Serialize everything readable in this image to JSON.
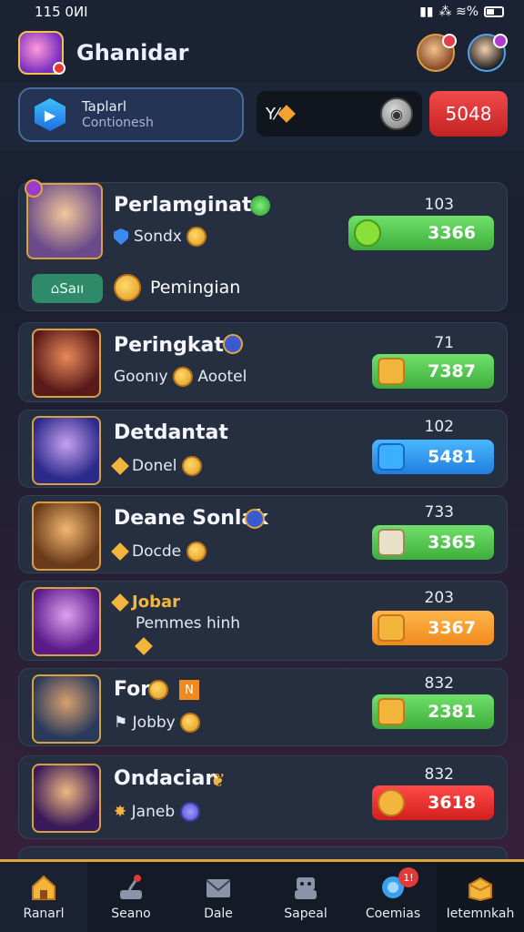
{
  "status_bar": {
    "time": "115 0ИI",
    "right": "⁂ ≋%"
  },
  "header": {
    "title": "Ghanidar"
  },
  "profile": {
    "name": "Taplarl",
    "subtitle": "Contionesh"
  },
  "currency": {
    "label": "Y⁄ ",
    "score": "5048"
  },
  "rows": [
    {
      "name": "Perlamginat",
      "sub": "Sondx",
      "top": "103",
      "value": "3366",
      "pill_color": "green",
      "shop_label": "Saıı",
      "extra_label": "Pemingian"
    },
    {
      "name": "Peringkat",
      "sub": "Goonıy",
      "sub2": "Aootel",
      "top": "71",
      "value": "7387",
      "pill_color": "green"
    },
    {
      "name": "Detdantat",
      "sub": "Donel",
      "top": "102",
      "value": "5481",
      "pill_color": "blue"
    },
    {
      "name": "Deane Sonlak",
      "sub": "Docde",
      "top": "733",
      "value": "3365",
      "pill_color": "green"
    },
    {
      "name": "Jobar",
      "sub": "Pemmes hinh",
      "top": "203",
      "value": "3367",
      "pill_color": "orange"
    },
    {
      "name": "For",
      "sub": "Jobby",
      "top": "832",
      "value": "2381",
      "pill_color": "green"
    },
    {
      "name": "Ondacian",
      "sub": "Janeb",
      "top": "832",
      "value": "3618",
      "pill_color": "red"
    }
  ],
  "nav": [
    {
      "label": "Ranarl",
      "icon": "home-icon"
    },
    {
      "label": "Seano",
      "icon": "joystick-icon"
    },
    {
      "label": "Dale",
      "icon": "mail-icon"
    },
    {
      "label": "Sapeal",
      "icon": "robot-icon"
    },
    {
      "label": "Coemias",
      "icon": "globe-icon",
      "badge": "1!"
    },
    {
      "label": "Ietemnkah",
      "icon": "chest-icon"
    }
  ],
  "colors": {
    "accent": "#e0a53c",
    "green": "#3fae3c",
    "blue": "#1f7ee0",
    "orange": "#f08a1c",
    "red": "#d41e1e"
  }
}
